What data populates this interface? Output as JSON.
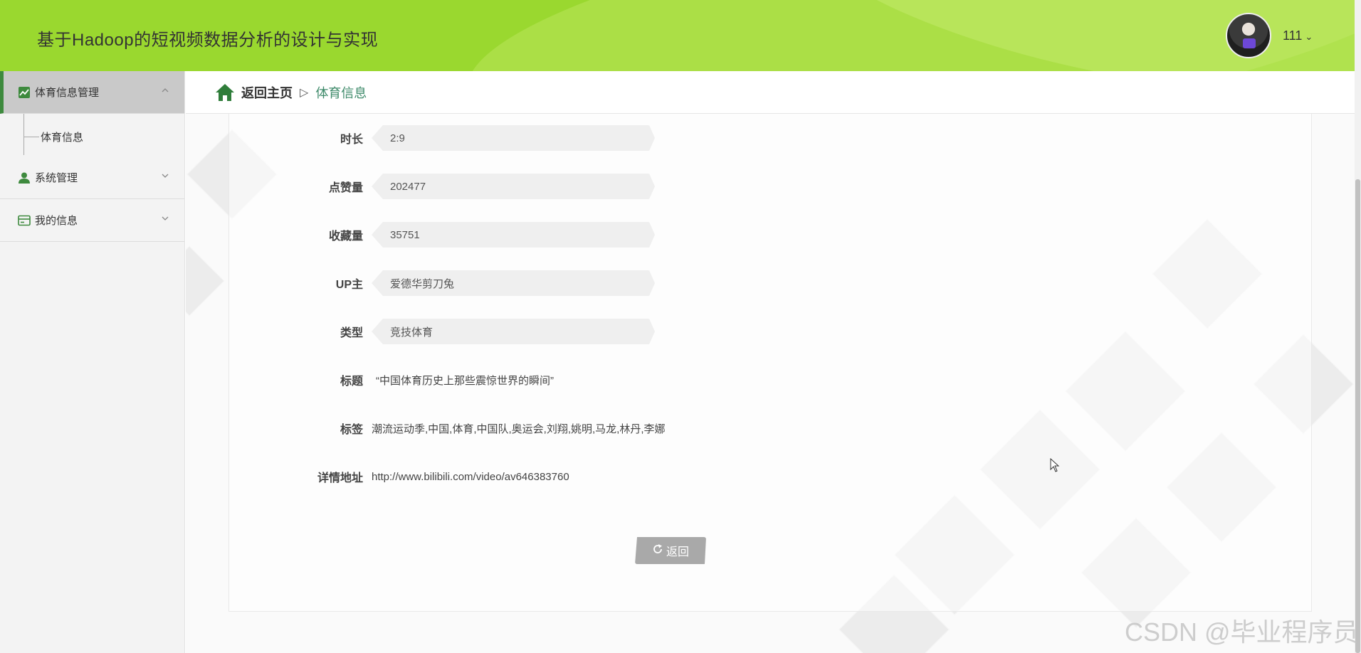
{
  "app": {
    "title": "基于Hadoop的短视频数据分析的设计与实现",
    "user_name": "111",
    "user_chevron": "⌄"
  },
  "sidebar": {
    "menus": [
      {
        "label": "体育信息管理",
        "icon": "chart-line-icon",
        "expanded": true,
        "children": [
          {
            "label": "体育信息"
          }
        ]
      },
      {
        "label": "系统管理",
        "icon": "user-icon",
        "expanded": false
      },
      {
        "label": "我的信息",
        "icon": "card-icon",
        "expanded": false
      }
    ]
  },
  "breadcrumb": {
    "home_label": "返回主页",
    "separator": "▷",
    "current": "体育信息"
  },
  "form": {
    "duration": {
      "label": "时长",
      "value": "2:9"
    },
    "likes": {
      "label": "点赞量",
      "value": "202477"
    },
    "favorites": {
      "label": "收藏量",
      "value": "35751"
    },
    "uploader": {
      "label": "UP主",
      "value": "爱德华剪刀兔"
    },
    "category": {
      "label": "类型",
      "value": "竞技体育"
    },
    "title": {
      "label": "标题",
      "value": "“中国体育历史上那些震惊世界的瞬间”"
    },
    "tags": {
      "label": "标签",
      "value": "潮流运动季,中国,体育,中国队,奥运会,刘翔,姚明,马龙,林丹,李娜"
    },
    "url": {
      "label": "详情地址",
      "value": "http://www.bilibili.com/video/av646383760"
    },
    "back_button": "返回"
  },
  "watermark": "CSDN @毕业程序员",
  "colors": {
    "header_bg": "#9ad82f",
    "accent_green": "#3e8a3e",
    "breadcrumb_current": "#3e8a6a",
    "button_bg": "#a9a9a9"
  }
}
